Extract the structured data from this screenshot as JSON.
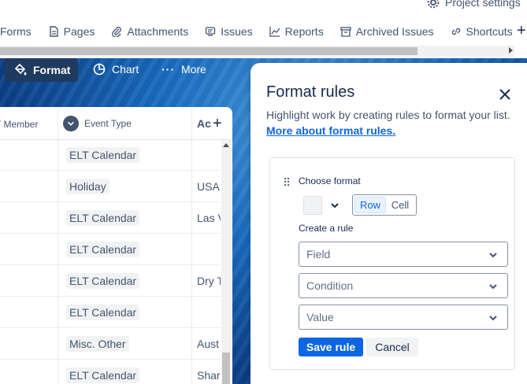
{
  "header": {
    "project_settings": "Project settings",
    "tabs": [
      {
        "label": "Forms",
        "icon": "forms-icon"
      },
      {
        "label": "Pages",
        "icon": "pages-icon"
      },
      {
        "label": "Attachments",
        "icon": "attachment-icon"
      },
      {
        "label": "Issues",
        "icon": "issues-icon"
      },
      {
        "label": "Reports",
        "icon": "reports-icon"
      },
      {
        "label": "Archived Issues",
        "icon": "archive-icon"
      },
      {
        "label": "Shortcuts",
        "icon": "link-icon"
      }
    ],
    "add": "+"
  },
  "toolbar": {
    "format": "Format",
    "chart": "Chart",
    "more": "More"
  },
  "table": {
    "columns": {
      "member": "T Member",
      "event_type": "Event Type",
      "ac": "Ac"
    },
    "add_column": "+",
    "rows": [
      {
        "event_type": "ELT Calendar",
        "location": ""
      },
      {
        "event_type": "Holiday",
        "location": "USA"
      },
      {
        "event_type": "ELT Calendar",
        "location": "Las V"
      },
      {
        "event_type": "ELT Calendar",
        "location": ""
      },
      {
        "event_type": "ELT Calendar",
        "location": "Dry T"
      },
      {
        "event_type": "ELT Calendar",
        "location": ""
      },
      {
        "event_type": "Misc. Other",
        "location": "Aust"
      },
      {
        "event_type": "ELT Calendar",
        "location": "Shar"
      }
    ]
  },
  "panel": {
    "title": "Format rules",
    "description": "Highlight work by creating rules to format your list.",
    "link": "More about format rules.",
    "choose_format": "Choose format",
    "scope": {
      "row": "Row",
      "cell": "Cell",
      "selected": "Row"
    },
    "create_rule": "Create a rule",
    "field_placeholder": "Field",
    "condition_placeholder": "Condition",
    "value_placeholder": "Value",
    "save": "Save rule",
    "cancel": "Cancel"
  },
  "colors": {
    "primary": "#0c66e4",
    "format_button": "#1e3a5f",
    "text": "#172b4d",
    "subtle_text": "#44546f"
  }
}
